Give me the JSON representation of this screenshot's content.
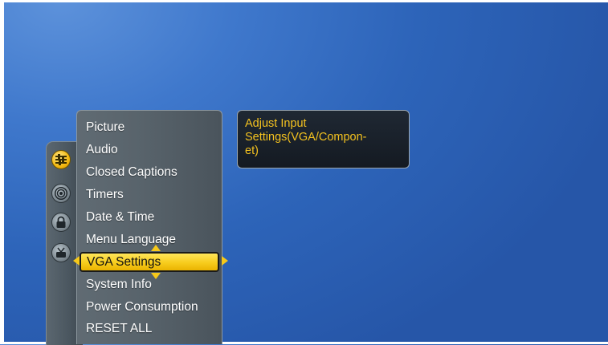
{
  "categories": [
    {
      "icon": "audio-sliders-icon",
      "selected": true
    },
    {
      "icon": "broadcast-signal-icon",
      "selected": false
    },
    {
      "icon": "lock-icon",
      "selected": false
    },
    {
      "icon": "tv-antenna-icon",
      "selected": false
    }
  ],
  "menu": {
    "items": [
      "Picture",
      "Audio",
      "Closed Captions",
      "Timers",
      "Date & Time",
      "Menu Language",
      "VGA Settings",
      "System Info",
      "Power Consumption",
      "RESET ALL"
    ],
    "selected_index": 6,
    "selected_label": "VGA Settings"
  },
  "info": {
    "text": "Adjust Input\nSettings(VGA/Compon-\net)"
  },
  "colors": {
    "accent": "#f7cc1d",
    "info_text": "#f4c21f",
    "background": "#2d64b9"
  }
}
